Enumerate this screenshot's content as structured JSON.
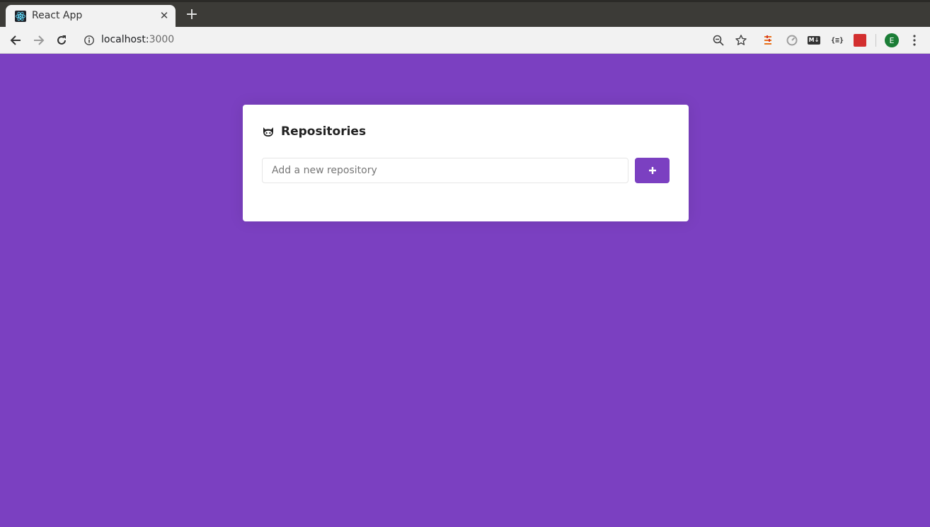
{
  "browser": {
    "tab_title": "React App",
    "url_host": "localhost:",
    "url_port": "3000",
    "profile_initial": "E",
    "extensions": [
      "stack-icon",
      "speedometer-icon",
      "markdown-icon",
      "json-viewer-icon",
      "red-extension-icon"
    ],
    "json_ext_label": "{≡}",
    "markdown_ext_label": "M↓"
  },
  "page": {
    "background_color": "#7b40c1",
    "card": {
      "title": "Repositories",
      "input_placeholder": "Add a new repository",
      "input_value": "",
      "add_button_label": "+"
    }
  },
  "colors": {
    "accent": "#7b40c1",
    "profile": "#1b7d36"
  }
}
